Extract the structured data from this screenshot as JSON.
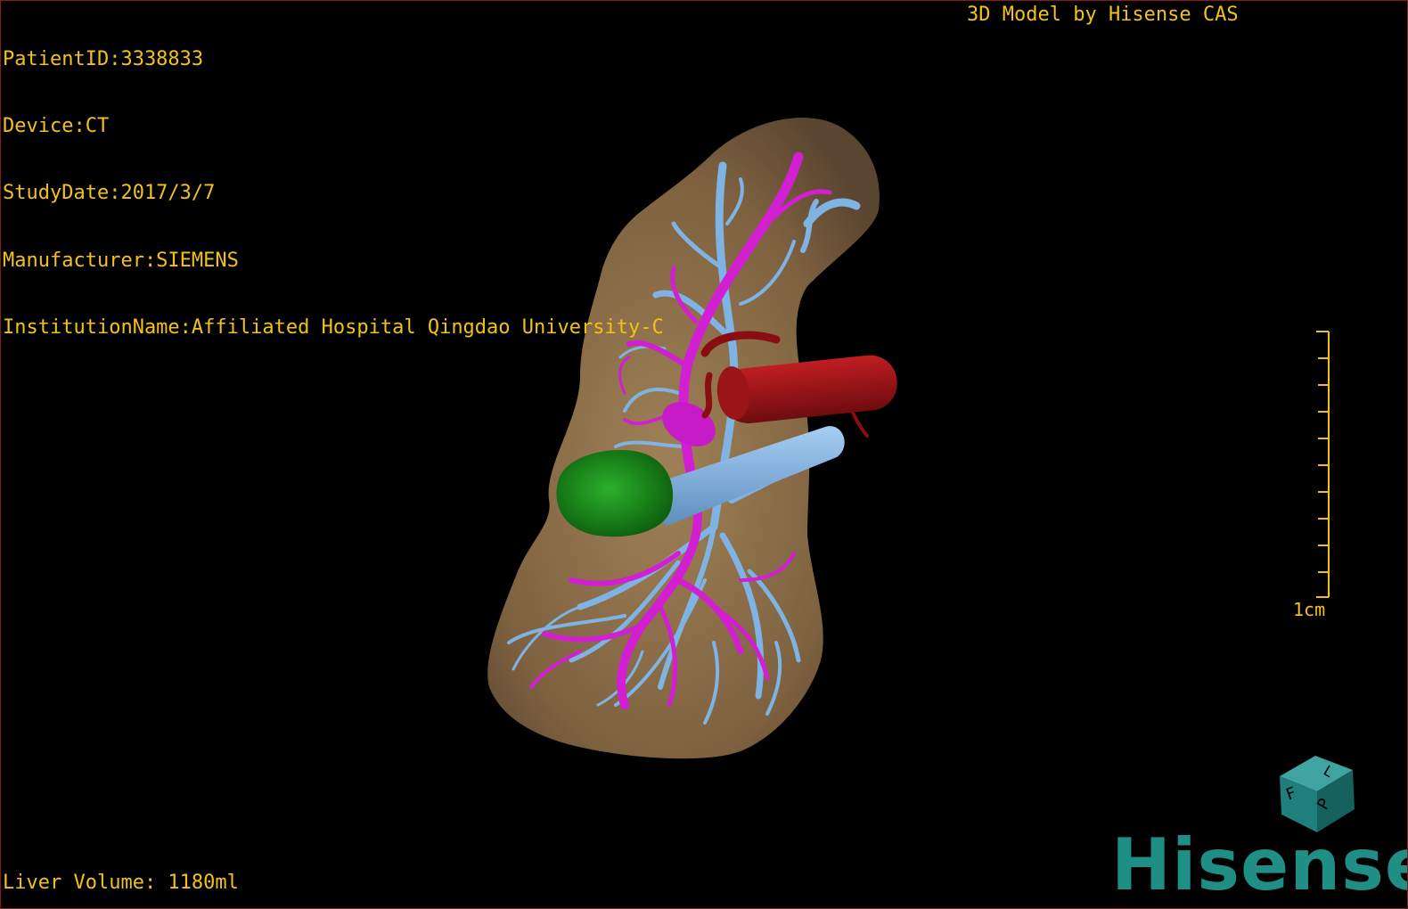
{
  "overlay": {
    "patient_id": "PatientID:3338833",
    "device": "Device:CT",
    "study_date": "StudyDate:2017/3/7",
    "manufacturer": "Manufacturer:SIEMENS",
    "institution": "InstitutionName:Affiliated Hospital Qingdao University-C",
    "credit": "3D Model by Hisense CAS",
    "liver_volume": "Liver Volume: 1180ml",
    "scale_bar_label": "1cm"
  },
  "orientation_cube": {
    "faces": [
      "F",
      "L",
      "P"
    ]
  },
  "brand": {
    "logo_text": "Hisense"
  },
  "colors": {
    "overlay_text": "#f2c21a",
    "liver": "#8a6d47",
    "portal_vein": "#d21fd2",
    "hepatic_vein": "#7fb3e3",
    "artery": "#a8141a",
    "lesion": "#1f8f1f",
    "logo": "#1f8f86"
  }
}
